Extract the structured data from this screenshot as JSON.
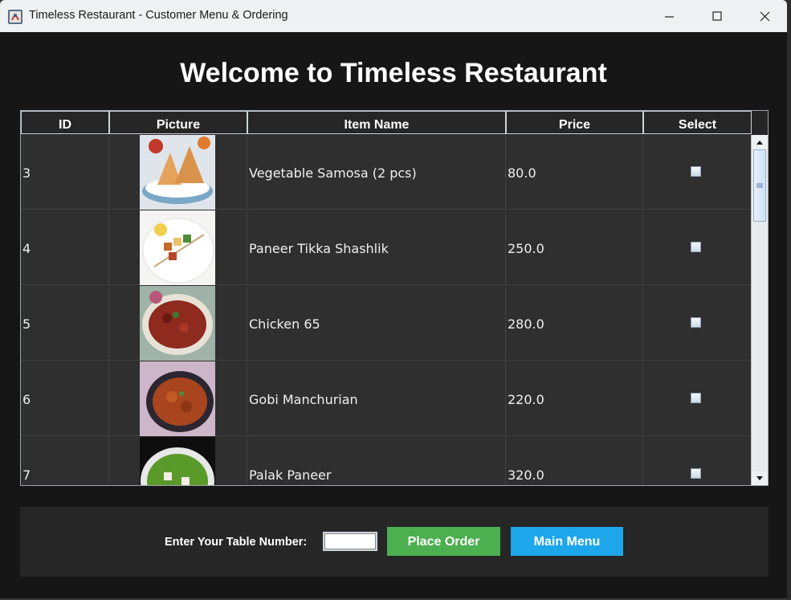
{
  "window": {
    "title": "Timeless Restaurant - Customer Menu & Ordering"
  },
  "page": {
    "heading": "Welcome to Timeless Restaurant"
  },
  "table": {
    "columns": [
      "ID",
      "Picture",
      "Item Name",
      "Price",
      "Select"
    ],
    "rows": [
      {
        "id": "3",
        "picture": "samosa-photo",
        "name": "Vegetable Samosa (2 pcs)",
        "price": "80.0",
        "selected": false
      },
      {
        "id": "4",
        "picture": "paneer-tikka-photo",
        "name": "Paneer Tikka Shashlik",
        "price": "250.0",
        "selected": false
      },
      {
        "id": "5",
        "picture": "chicken-65-photo",
        "name": "Chicken 65",
        "price": "280.0",
        "selected": false
      },
      {
        "id": "6",
        "picture": "gobi-manchurian-photo",
        "name": "Gobi Manchurian",
        "price": "220.0",
        "selected": false
      },
      {
        "id": "7",
        "picture": "palak-paneer-photo",
        "name": "Palak Paneer",
        "price": "320.0",
        "selected": false
      }
    ]
  },
  "footer": {
    "table_label": "Enter Your Table Number:",
    "table_value": "",
    "place_order_label": "Place Order",
    "main_menu_label": "Main Menu"
  },
  "colors": {
    "place_order": "#4caf50",
    "main_menu": "#1ea6ea",
    "background": "#161616"
  }
}
